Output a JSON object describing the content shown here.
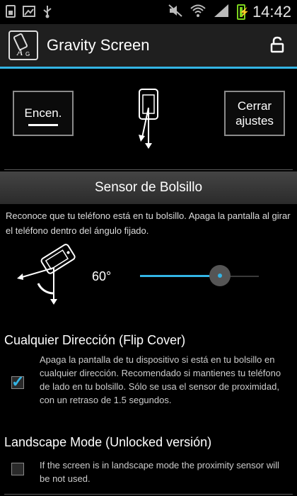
{
  "status_bar": {
    "time": "14:42",
    "icons": [
      "sim-icon",
      "image-icon",
      "usb-icon",
      "mute-icon",
      "wifi-icon",
      "signal-icon",
      "battery-charging-icon"
    ]
  },
  "action_bar": {
    "title": "Gravity Screen",
    "icon_letters": "AG",
    "accent": "#33b5e5"
  },
  "controls": {
    "on_label": "Encen.",
    "close_label_line1": "Cerrar",
    "close_label_line2": "ajustes"
  },
  "pocket_sensor": {
    "title": "Sensor de Bolsillo",
    "description": "Reconoce que tu teléfono está en tu bolsillo. Apaga la pantalla al girar el teléfono dentro del ángulo fijado.",
    "angle_label": "60°",
    "slider_fraction": 0.67
  },
  "preferences": [
    {
      "title": "Cualquier Dirección (Flip Cover)",
      "summary": "Apaga la pantalla de tu dispositivo si está en tu bolsillo en cualquier dirección. Recomendado si mantienes tu teléfono de lado en tu bolsillo. Sólo se usa el sensor de proximidad, con un retraso de 1.5 segundos.",
      "checked": true
    },
    {
      "title": "Landscape Mode (Unlocked versión)",
      "summary": "If the screen is in landscape mode the proximity sensor will be not used.",
      "checked": false
    }
  ]
}
